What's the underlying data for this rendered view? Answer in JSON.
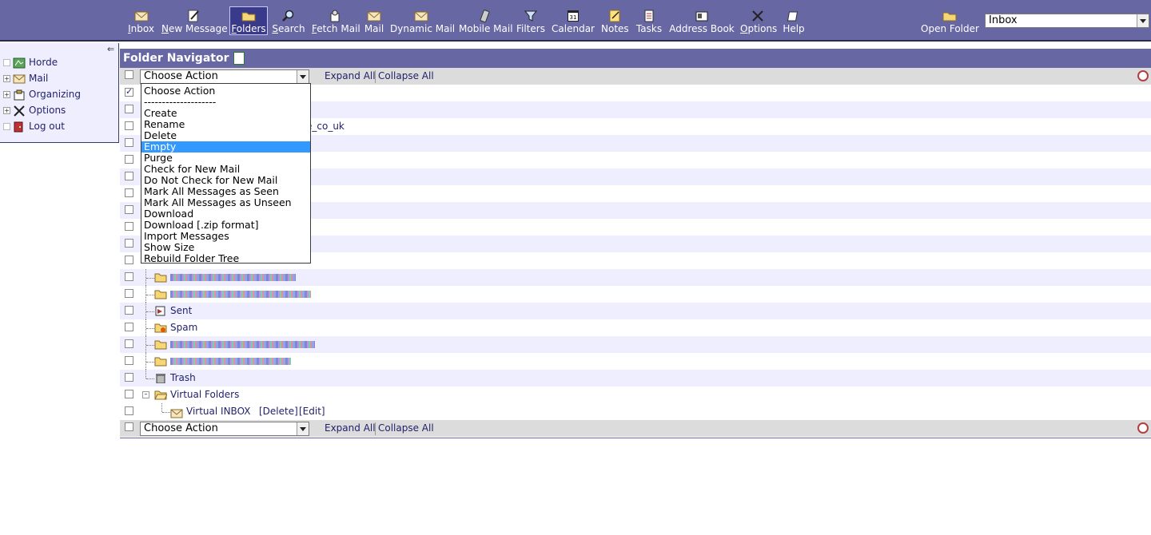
{
  "toolbar": {
    "items": [
      {
        "label": "Inbox",
        "underline": "I",
        "rest": "nbox",
        "icon": "envelope-icon"
      },
      {
        "label": "New Message",
        "underline": "N",
        "rest": "ew Message",
        "icon": "compose-icon"
      },
      {
        "label": "Folders",
        "underline": "F",
        "rest": "olders",
        "icon": "folders-icon"
      },
      {
        "label": "Search",
        "underline": "S",
        "rest": "earch",
        "icon": "magnifier-icon"
      },
      {
        "label": "Fetch Mail",
        "underline": "F",
        "rest": "etch Mail",
        "icon": "fetch-mail-icon"
      },
      {
        "label": "Mail",
        "underline": "",
        "rest": "Mail",
        "icon": "mail-icon"
      },
      {
        "label": "Dynamic Mail",
        "underline": "",
        "rest": "Dynamic Mail",
        "icon": "dynamic-mail-icon"
      },
      {
        "label": "Mobile Mail",
        "underline": "",
        "rest": "Mobile Mail",
        "icon": "mobile-icon"
      },
      {
        "label": "Filters",
        "underline": "",
        "rest": "Filters",
        "icon": "filter-icon"
      },
      {
        "label": "Calendar",
        "underline": "",
        "rest": "Calendar",
        "icon": "calendar-icon"
      },
      {
        "label": "Notes",
        "underline": "",
        "rest": "Notes",
        "icon": "notes-icon"
      },
      {
        "label": "Tasks",
        "underline": "",
        "rest": "Tasks",
        "icon": "tasks-icon"
      },
      {
        "label": "Address Book",
        "underline": "",
        "rest": "Address Book",
        "icon": "address-book-icon"
      },
      {
        "label": "Options",
        "underline": "O",
        "rest": "ptions",
        "icon": "options-icon"
      },
      {
        "label": "Help",
        "underline": "",
        "rest": "Help",
        "icon": "help-icon"
      }
    ],
    "open_folder_label": "Open Folder",
    "open_folder_underline": "l",
    "folder_select_value": "Inbox"
  },
  "sidebar": {
    "items": [
      {
        "label": "Horde",
        "icon": "horde-icon"
      },
      {
        "label": "Mail",
        "icon": "mail-icon"
      },
      {
        "label": "Organizing",
        "icon": "organizing-icon"
      },
      {
        "label": "Options",
        "icon": "options-icon"
      },
      {
        "label": "Log out",
        "icon": "logout-icon"
      }
    ]
  },
  "main": {
    "title": "Folder Navigator",
    "action_select_value": "Choose Action",
    "expand_all": "Expand All",
    "collapse_all": "Collapse All",
    "partial_folder_text": "e_co_uk",
    "folders": [
      {
        "name": "Sent",
        "icon": "sent-folder-icon"
      },
      {
        "name": "Spam",
        "icon": "spam-folder-icon"
      },
      {
        "name": "Trash",
        "icon": "trash-folder-icon"
      },
      {
        "name": "Virtual Folders",
        "icon": "open-folder-icon"
      },
      {
        "name": "Virtual INBOX",
        "icon": "envelope-icon"
      }
    ],
    "virtual_delete": "[Delete]",
    "virtual_edit": "[Edit]"
  },
  "dropdown": {
    "options": [
      "Choose Action",
      "--------------------",
      "Create",
      "Rename",
      "Delete",
      "Empty",
      "Purge",
      "Check for New Mail",
      "Do Not Check for New Mail",
      "Mark All Messages as Seen",
      "Mark All Messages as Unseen",
      "Download",
      "Download [.zip format]",
      "Import Messages",
      "Show Size",
      "Rebuild Folder Tree"
    ],
    "selected": "Empty"
  }
}
